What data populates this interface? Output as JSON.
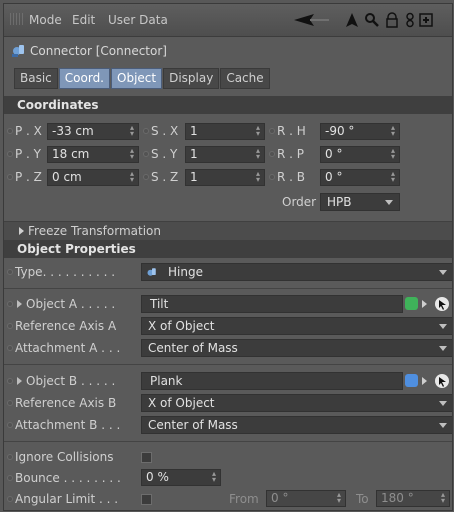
{
  "menubar": {
    "items": [
      "Mode",
      "Edit",
      "User Data"
    ],
    "icons": [
      "back-arrow-icon",
      "cursor-icon",
      "search-icon",
      "lock-icon",
      "link-icon",
      "new-panel-icon"
    ]
  },
  "object": {
    "title": "Connector [Connector]",
    "icon": "connector-icon"
  },
  "tabs": [
    {
      "label": "Basic",
      "active": false
    },
    {
      "label": "Coord.",
      "active": true
    },
    {
      "label": "Object",
      "active": true
    },
    {
      "label": "Display",
      "active": false
    },
    {
      "label": "Cache",
      "active": false
    }
  ],
  "coordinates": {
    "header": "Coordinates",
    "px": {
      "label": "P . X",
      "value": "-33 cm"
    },
    "py": {
      "label": "P . Y",
      "value": "18 cm"
    },
    "pz": {
      "label": "P . Z",
      "value": "0 cm"
    },
    "sx": {
      "label": "S . X",
      "value": "1"
    },
    "sy": {
      "label": "S . Y",
      "value": "1"
    },
    "sz": {
      "label": "S . Z",
      "value": "1"
    },
    "rh": {
      "label": "R . H",
      "value": "-90 °"
    },
    "rp": {
      "label": "R . P",
      "value": "0 °"
    },
    "rb": {
      "label": "R . B",
      "value": "0 °"
    },
    "order_label": "Order",
    "order_value": "HPB",
    "freeze": "Freeze Transformation"
  },
  "props": {
    "header": "Object Properties",
    "type_label": "Type. . . . . . . . . .",
    "type_value": "Hinge",
    "obja_label": "Object A . . . . .",
    "obja_value": "Tilt",
    "ref_a_label": "Reference Axis A",
    "ref_a_value": "X of Object",
    "att_a_label": "Attachment A . . .",
    "att_a_value": "Center of Mass",
    "objb_label": "Object B . . . . .",
    "objb_value": "Plank",
    "ref_b_label": "Reference Axis B",
    "ref_b_value": "X of Object",
    "att_b_label": "Attachment B . . .",
    "att_b_value": "Center of Mass",
    "ignore_label": "Ignore Collisions",
    "bounce_label": "Bounce . . . . . . . .",
    "bounce_value": "0 %",
    "angular_label": "Angular Limit . . .",
    "from_label": "From",
    "from_value": "0 °",
    "to_label": "To",
    "to_value": "180 °"
  },
  "colors": {
    "active_tab": "#7f97b8",
    "section_bg": "#3f3f3f",
    "field_bg": "#3c3c3c"
  }
}
